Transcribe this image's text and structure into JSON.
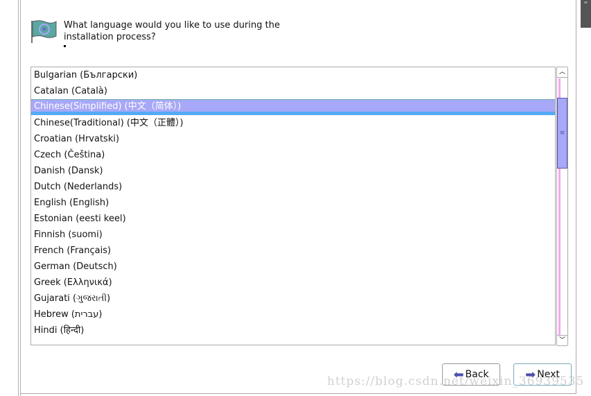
{
  "prompt": "What language would you like to use during the installation process?",
  "languages": [
    "Bulgarian (Български)",
    "Catalan (Català)",
    "Chinese(Simplified) (中文（简体）)",
    "Chinese(Traditional) (中文（正體）)",
    "Croatian (Hrvatski)",
    "Czech (Čeština)",
    "Danish (Dansk)",
    "Dutch (Nederlands)",
    "English (English)",
    "Estonian (eesti keel)",
    "Finnish (suomi)",
    "French (Français)",
    "German (Deutsch)",
    "Greek (Ελληνικά)",
    "Gujarati (ગુજરાતી)",
    "Hebrew (עברית)",
    "Hindi (हिन्दी)"
  ],
  "selected_index": 2,
  "buttons": {
    "back": "Back",
    "next": "Next"
  },
  "watermark": "https://blog.csdn.net/weixin_36939535",
  "corner": "“"
}
